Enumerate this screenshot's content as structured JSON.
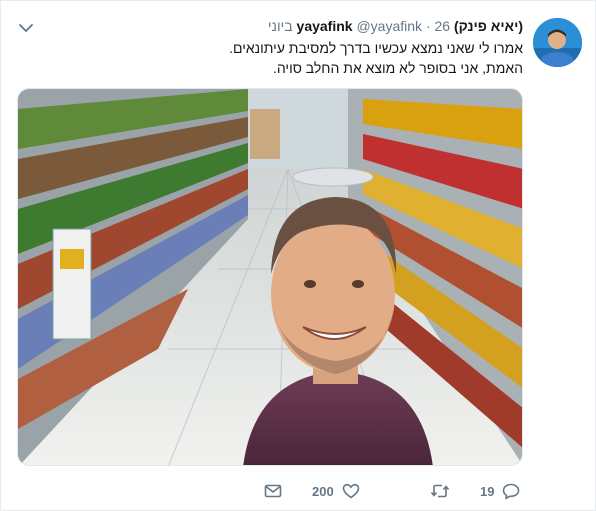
{
  "tweet": {
    "display_name": "(יאיא פינק) yayafink",
    "handle": "@yayafink",
    "separator": "·",
    "timestamp": "26 ביוני",
    "text_lines": [
      "אמרו לי שאני נמצא עכשיו בדרך למסיבת עיתונאים.",
      "האמת, אני בסופר לא מוצא את החלב סויה."
    ]
  },
  "actions": {
    "reply_count": "19",
    "retweet_count": "",
    "like_count": "200",
    "icons": [
      "reply-icon",
      "retweet-icon",
      "like-icon",
      "message-icon"
    ]
  },
  "colors": {
    "text": "#14171a",
    "secondary": "#657786",
    "border": "#e6ecf0",
    "avatar_bg": "#2a8fd6"
  }
}
